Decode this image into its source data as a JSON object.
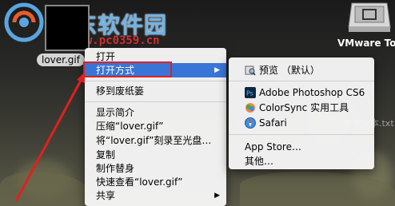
{
  "watermark": {
    "title": "河东软件园",
    "url": "www.pc0359.cn"
  },
  "desktop": {
    "file_label": "lover.gif",
    "vmware_label": "VMware Tool",
    "txt_label": "新建文本.txt"
  },
  "context_menu": {
    "items": [
      {
        "label": "打开"
      },
      {
        "label": "打开方式"
      },
      {
        "label": "移到废纸篓"
      },
      {
        "label": "显示简介"
      },
      {
        "label": "压缩“lover.gif”"
      },
      {
        "label": "将“lover.gif”刻录至光盘…"
      },
      {
        "label": "复制"
      },
      {
        "label": "制作替身"
      },
      {
        "label": "快速查看“lover.gif”"
      },
      {
        "label": "共享"
      }
    ],
    "highlight_color": "#3875d7"
  },
  "open_with_menu": {
    "items": [
      {
        "label": "预览 （默认）",
        "icon": "preview-icon"
      },
      {
        "label": "Adobe Photoshop CS6",
        "icon": "photoshop-icon"
      },
      {
        "label": "ColorSync 实用工具",
        "icon": "colorsync-icon"
      },
      {
        "label": "Safari",
        "icon": "safari-icon"
      },
      {
        "label": "App Store…"
      },
      {
        "label": "其他…"
      }
    ]
  },
  "annotation_color": "#e02020"
}
